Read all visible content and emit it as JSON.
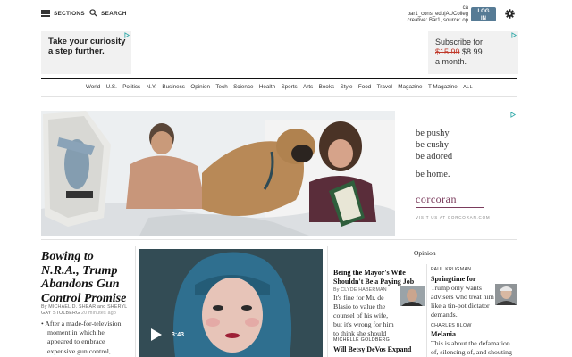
{
  "topbar": {
    "sections_label": "SECTIONS",
    "search_label": "SEARCH",
    "ad_meta_line1": "ca",
    "ad_meta_line2": "bar1_cons_edu|AUColleg",
    "ad_meta_line3": "creative: Bar1, source: op",
    "login_label_line1": "LOG",
    "login_label_line2": "IN",
    "login_color": "#567b95"
  },
  "ads": {
    "left_text": "Take your curiosity a step further.",
    "right_line1": "Subscribe for",
    "right_old_price": "$15.99",
    "right_new_price": "$8.99",
    "right_line3": "a month."
  },
  "nav": {
    "items": [
      "World",
      "U.S.",
      "Politics",
      "N.Y.",
      "Business",
      "Opinion",
      "Tech",
      "Science",
      "Health",
      "Sports",
      "Arts",
      "Books",
      "Style",
      "Food",
      "Travel",
      "Magazine",
      "T Magazine"
    ],
    "all_label": "ALL"
  },
  "big_ad": {
    "tagline_1": "be pushy",
    "tagline_2": "be cushy",
    "tagline_3": "be adored",
    "tagline_4": "be home.",
    "brand": "corcoran",
    "brand_color": "#7a3b5c",
    "visit": "VISIT US AT CORCORAN.COM"
  },
  "lead": {
    "headline": "Bowing to N.R.A., Trump Abandons Gun Control Promise",
    "byline": "By MICHAEL D. SHEAR and SHERYL GAY STOLBERG",
    "time": "20 minutes ago",
    "summary_lines": [
      "After a made-for-television",
      "moment in which he",
      "appeared to embrace",
      "expensive gun control,"
    ],
    "video_duration": "3:43"
  },
  "opinion": {
    "section_title": "Opinion",
    "story1_headline": "Being the Mayor's Wife Shouldn't Be a Paying Job",
    "story1_byline": "By CLYDE HABERMAN",
    "story1_body": "It's fine for Mr. de Blasio to value the counsel of his wife, but it's wrong for him to think she should",
    "story2_kicker": "MICHELLE GOLDBERG",
    "story2_headline": "Will Betsy DeVos Expand",
    "story3_kicker": "PAUL KRUGMAN",
    "story3_headline": "Springtime for",
    "story3_body": "Trump only wants advisers who treat him like a tin-pot dictator demands.",
    "story4_kicker": "CHARLES BLOW",
    "story4_headline": "Melania",
    "story4_body": "This is about the defamation of, silencing of, and shouting"
  }
}
